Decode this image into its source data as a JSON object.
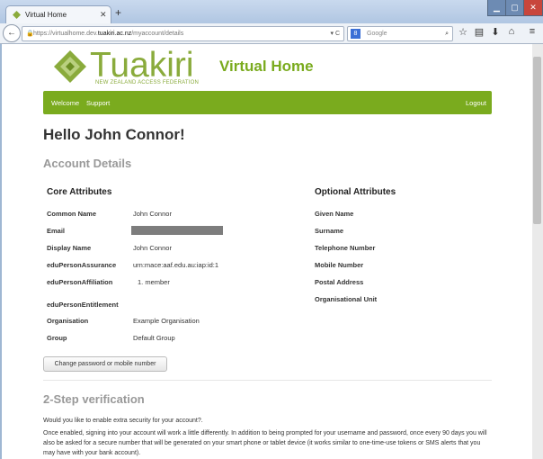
{
  "browser": {
    "tab_title": "Virtual Home",
    "new_tab": "+",
    "url_host_prefix": "https://virtualhome.dev.",
    "url_host_bold": "tuakiri.ac.nz",
    "url_path": "/myaccount/details",
    "search_placeholder": "Google"
  },
  "header": {
    "brand": "Tuakiri",
    "tagline": "NEW ZEALAND ACCESS FEDERATION",
    "app_title": "Virtual Home"
  },
  "nav": {
    "welcome": "Welcome",
    "support": "Support",
    "logout": "Logout"
  },
  "main": {
    "greeting": "Hello John Connor!",
    "account_details": "Account Details",
    "core_title": "Core Attributes",
    "optional_title": "Optional Attributes",
    "core": [
      {
        "label": "Common Name",
        "value": "John Connor"
      },
      {
        "label": "Email",
        "value": ""
      },
      {
        "label": "Display Name",
        "value": "John Connor"
      },
      {
        "label": "eduPersonAssurance",
        "value": "urn:mace:aaf.edu.au:iap:id:1"
      },
      {
        "label": "eduPersonAffiliation",
        "value": "1.  member"
      },
      {
        "label": "eduPersonEntitlement",
        "value": ""
      },
      {
        "label": "Organisation",
        "value": "Example Organisation"
      },
      {
        "label": "Group",
        "value": "Default Group"
      }
    ],
    "optional": [
      "Given Name",
      "Surname",
      "Telephone Number",
      "Mobile Number",
      "Postal Address",
      "Organisational Unit"
    ],
    "change_button": "Change password or mobile number",
    "two_step_title": "2-Step verification",
    "two_step_intro": "Would you like to enable extra security for your account?.",
    "two_step_body": "Once enabled, signing into your account will work a little differently. In addition to being prompted for your username and password, once every 90 days you will also be asked for a secure number that will be generated on your smart phone or tablet device (it works similar to one-time-use tokens or SMS alerts that you may have with your bank account)."
  },
  "colors": {
    "accent_green": "#7aab1e",
    "heading_gray": "#999999"
  }
}
